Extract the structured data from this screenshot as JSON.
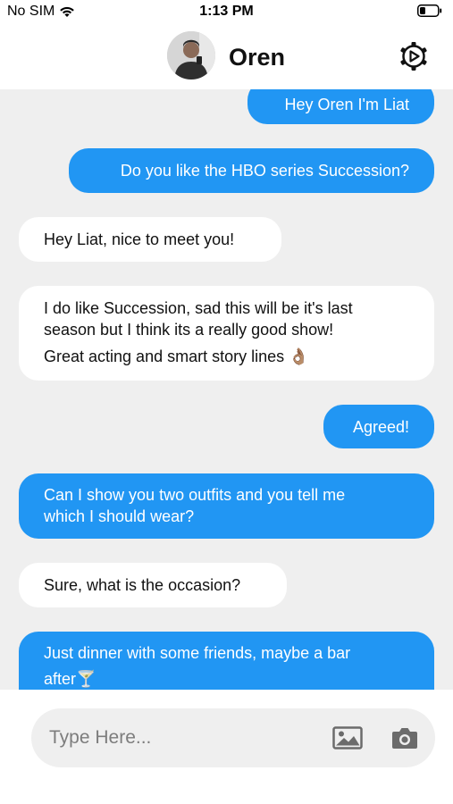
{
  "status_bar": {
    "carrier": "No SIM",
    "time": "1:13 PM"
  },
  "header": {
    "contact_name": "Oren"
  },
  "messages": [
    {
      "direction": "outgoing",
      "lines": [
        "Hey Oren I'm Liat"
      ]
    },
    {
      "direction": "outgoing",
      "lines": [
        "Do you like the HBO series Succession?"
      ]
    },
    {
      "direction": "incoming",
      "lines": [
        "Hey Liat, nice to meet you!"
      ]
    },
    {
      "direction": "incoming",
      "lines": [
        "I do like Succession, sad this will be it's last",
        "season but I think its a really good show!",
        "Great acting and smart story lines 👌🏽"
      ]
    },
    {
      "direction": "outgoing",
      "lines": [
        "Agreed!"
      ]
    },
    {
      "direction": "outgoing",
      "lines": [
        "Can I show you two outfits and you tell me",
        "which I should wear?"
      ]
    },
    {
      "direction": "incoming",
      "lines": [
        "Sure, what is the occasion?"
      ]
    },
    {
      "direction": "outgoing",
      "lines": [
        "Just dinner with some friends, maybe a bar",
        "after🍸"
      ]
    }
  ],
  "composer": {
    "placeholder": "Type Here..."
  },
  "colors": {
    "outgoing_bubble": "#2196f3",
    "incoming_bubble": "#ffffff",
    "chat_background": "#efefef"
  },
  "icons": {
    "wifi": "wifi-icon",
    "battery": "battery-icon",
    "settings": "settings-icon",
    "image": "image-icon",
    "camera": "camera-icon"
  }
}
